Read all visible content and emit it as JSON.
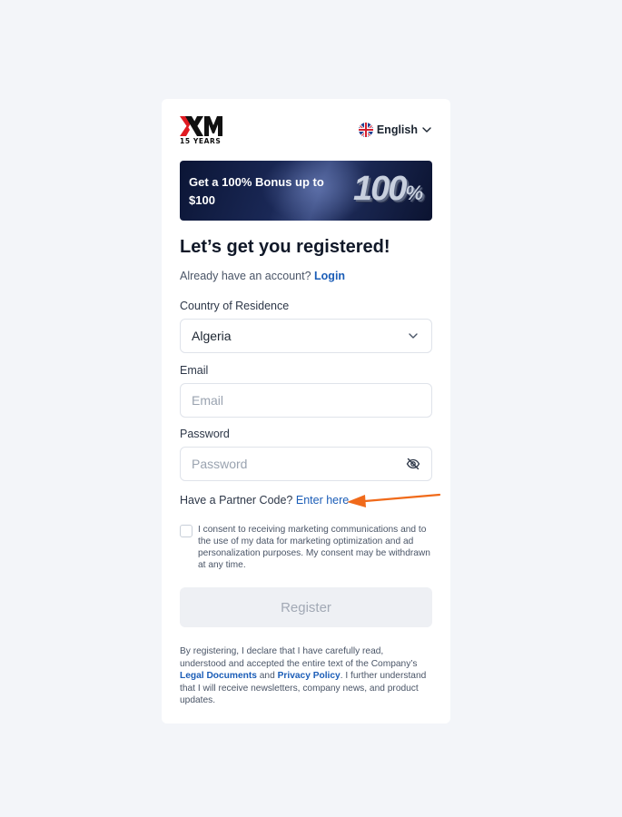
{
  "header": {
    "logo_text": "XM",
    "logo_subtitle": "15 YEARS",
    "language": "English"
  },
  "banner": {
    "text": "Get a 100% Bonus up to $100",
    "big_number": "100",
    "big_symbol": "%"
  },
  "title": "Let’s get you registered!",
  "account_prompt": {
    "text": "Already have an account?",
    "link": "Login"
  },
  "country": {
    "label": "Country of Residence",
    "value": "Algeria"
  },
  "email": {
    "label": "Email",
    "placeholder": "Email"
  },
  "password": {
    "label": "Password",
    "placeholder": "Password"
  },
  "partner": {
    "text": "Have a Partner Code?",
    "link": "Enter here"
  },
  "consent": {
    "checked": false,
    "text": "I consent to receiving marketing communications and to the use of my data for marketing optimization and ad personalization purposes. My consent may be withdrawn at any time."
  },
  "register_label": "Register",
  "legal": {
    "part1": "By registering, I declare that I have carefully read, understood and accepted the entire text of the Company’s",
    "link1": "Legal Documents",
    "and": "and",
    "link2": "Privacy Policy",
    "part2": ". I further understand that I will receive newsletters, company news, and product updates."
  },
  "colors": {
    "link": "#1b5db7",
    "arrow": "#f06a1a",
    "logo_red": "#e11b22",
    "page_bg": "#f3f5f9"
  }
}
